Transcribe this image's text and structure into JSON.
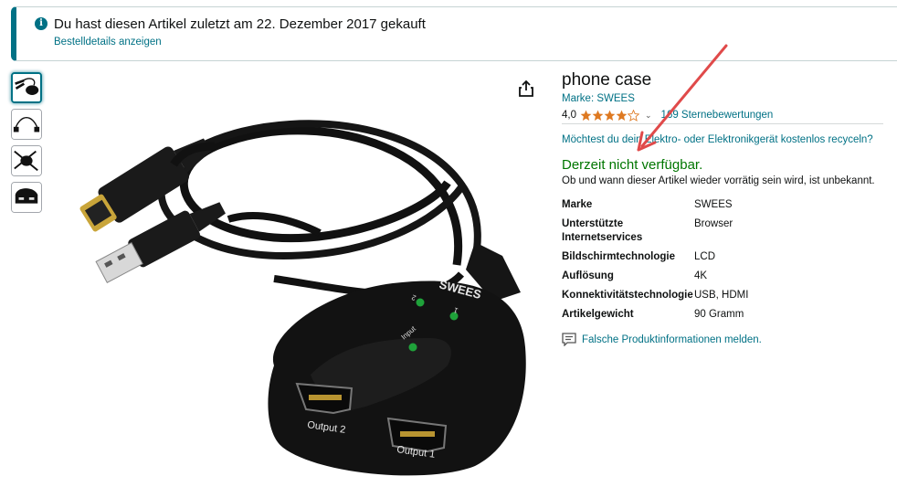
{
  "notice": {
    "icon": "info-icon",
    "message": "Du hast diesen Artikel zuletzt am 22. Dezember 2017 gekauft",
    "link": "Bestelldetails anzeigen"
  },
  "product": {
    "title": "phone case",
    "brand_link": "Marke: SWEES",
    "rating_value": "4,0",
    "rating_stars": 4,
    "rating_count": "169 Sternebewertungen",
    "recycle_link": "Möchtest du dein Elektro- oder Elektronikgerät kostenlos recyceln?",
    "availability": "Derzeit nicht verfügbar.",
    "availability_sub": "Ob und wann dieser Artikel wieder vorrätig sein wird, ist unbekannt.",
    "report_link": "Falsche Produktinformationen melden."
  },
  "specs": [
    {
      "key": "Marke",
      "value": "SWEES"
    },
    {
      "key": "Unterstützte Internetservices",
      "value": "Browser"
    },
    {
      "key": "Bildschirmtechnologie",
      "value": "LCD"
    },
    {
      "key": "Auflösung",
      "value": "4K"
    },
    {
      "key": "Konnektivitätstechnologie",
      "value": "USB, HDMI"
    },
    {
      "key": "Artikelgewicht",
      "value": "90 Gramm"
    }
  ],
  "image_labels": {
    "brand": "SWEES",
    "output1": "Output 1",
    "output2": "Output 2",
    "input": "Input",
    "port1": "1",
    "port2": "2"
  },
  "colors": {
    "link": "#007185",
    "available": "#007600",
    "star": "#de7921",
    "arrow": "#e04a4a"
  }
}
